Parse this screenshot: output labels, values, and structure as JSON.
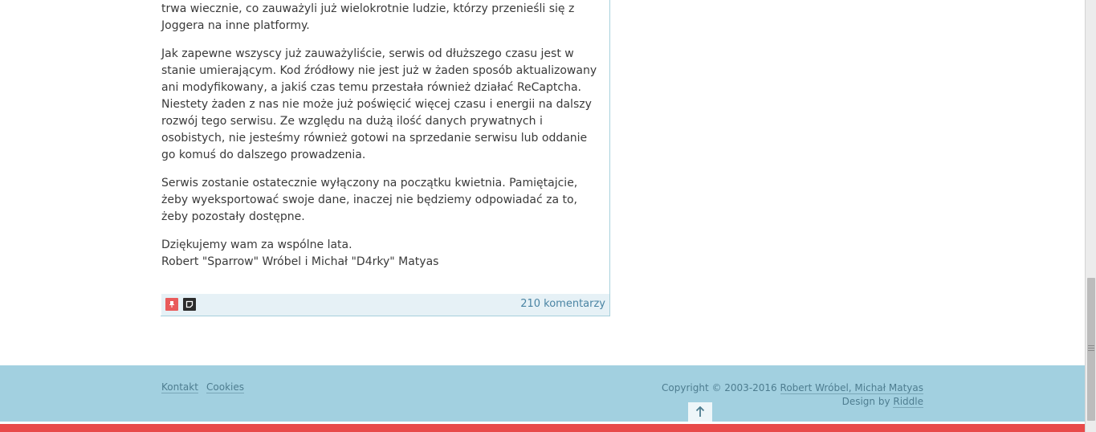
{
  "post": {
    "paragraphs": [
      "tworzyliśmy zręby wczesnego polskiego internetu. Niestety nic co dobre nie trwa wiecznie, co zauważyli już wielokrotnie ludzie, którzy przenieśli się z Joggera na inne platformy.",
      "Jak zapewne wszyscy już zauważyliście, serwis od dłuższego czasu jest w stanie umierającym. Kod źródłowy nie jest już w żaden sposób aktualizowany ani modyfikowany, a jakiś czas temu przestała również działać ReCaptcha. Niestety żaden z nas nie może już poświęcić więcej czasu i energii na dalszy rozwój tego serwisu. Ze względu na dużą ilość danych prywatnych i osobistych, nie jesteśmy również gotowi na sprzedanie serwisu lub oddanie go komuś do dalszego prowadzenia.",
      "Serwis zostanie ostatecznie wyłączony na początku kwietnia. Pamiętajcie, żeby wyeksportować swoje dane, inaczej nie będziemy odpowiadać za to, żeby pozostały dostępne."
    ],
    "closing_line1": "Dziękujemy wam za wspólne lata.",
    "closing_line2": "Robert \"Sparrow\" Wróbel i Michał \"D4rky\" Matyas",
    "comments_link": "210 komentarzy",
    "icons": [
      "pin-icon",
      "note-icon"
    ]
  },
  "footer": {
    "contact_link": "Kontakt",
    "cookies_link": "Cookies",
    "copyright_prefix": "Copyright © 2003-2016",
    "copyright_authors": "Robert Wróbel, Michał Matyas",
    "design_prefix": "Design by",
    "design_author": "Riddle",
    "back_to_top_icon": "arrow-up-icon"
  },
  "colors": {
    "accent": "#e84a4a",
    "footer_bg": "#a2d0e0",
    "link": "#4a84a3"
  }
}
